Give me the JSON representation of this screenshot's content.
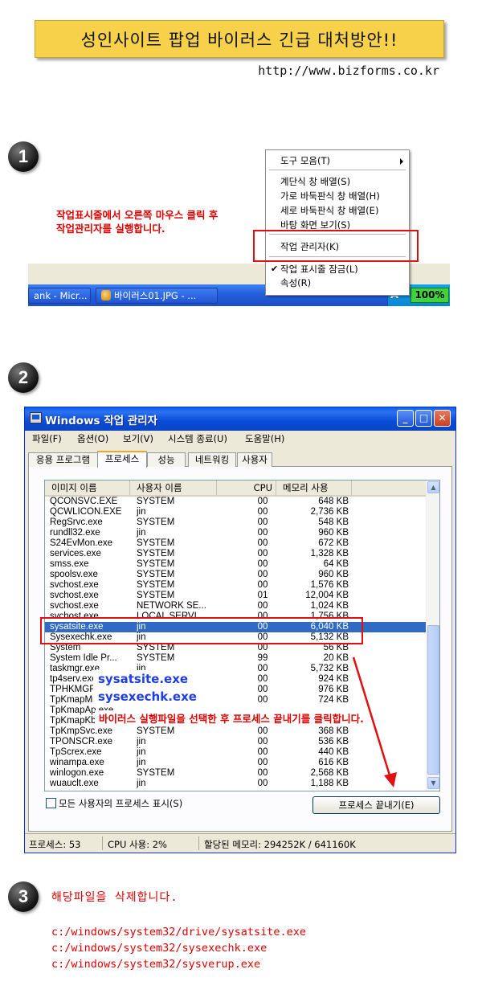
{
  "header": {
    "title": "성인사이트 팝업 바이러스 긴급 대처방안!!",
    "url": "http://www.bizforms.co.kr"
  },
  "step1": {
    "number": "1",
    "instruction_line1": "작업표시줄에서 오른쪽 마우스 클릭 후",
    "instruction_line2": "작업관리자를 실행합니다.",
    "context_menu": {
      "toolbar": "도구 모음(T)",
      "cascade": "계단식 창 배열(S)",
      "tile_h": "가로 바둑판식 창 배열(H)",
      "tile_v": "세로 바둑판식 창 배열(E)",
      "show_desktop": "바탕 화면 보기(S)",
      "task_manager": "작업 관리자(K)",
      "lock_taskbar": "작업 표시줄 잠금(L)",
      "properties": "속성(R)"
    },
    "taskbar": {
      "button1": "ank - Micr...",
      "button2": "바이러스01.JPG - ...",
      "tray_letter": "A",
      "percent": "100%"
    }
  },
  "step2": {
    "number": "2",
    "window": {
      "title": "Windows 작업 관리자",
      "menu": [
        "파일(F)",
        "옵션(O)",
        "보기(V)",
        "시스템 종료(U)",
        "도움말(H)"
      ],
      "tabs": [
        "응용 프로그램",
        "프로세스",
        "성능",
        "네트워킹",
        "사용자"
      ],
      "columns": [
        "이미지 이름",
        "사용자 이름",
        "CPU",
        "메모리 사용"
      ],
      "rows": [
        [
          "QCONSVC.EXE",
          "SYSTEM",
          "00",
          "648 KB"
        ],
        [
          "QCWLICON.EXE",
          "jin",
          "00",
          "2,736 KB"
        ],
        [
          "RegSrvc.exe",
          "SYSTEM",
          "00",
          "548 KB"
        ],
        [
          "rundll32.exe",
          "jin",
          "00",
          "960 KB"
        ],
        [
          "S24EvMon.exe",
          "SYSTEM",
          "00",
          "672 KB"
        ],
        [
          "services.exe",
          "SYSTEM",
          "00",
          "1,328 KB"
        ],
        [
          "smss.exe",
          "SYSTEM",
          "00",
          "64 KB"
        ],
        [
          "spoolsv.exe",
          "SYSTEM",
          "00",
          "960 KB"
        ],
        [
          "svchost.exe",
          "SYSTEM",
          "00",
          "1,576 KB"
        ],
        [
          "svchost.exe",
          "SYSTEM",
          "01",
          "12,004 KB"
        ],
        [
          "svchost.exe",
          "NETWORK SE...",
          "00",
          "1,024 KB"
        ],
        [
          "svchost.exe",
          "LOCAL SERVI...",
          "00",
          "1,756 KB"
        ],
        [
          "sysatsite.exe",
          "jin",
          "00",
          "6,040 KB"
        ],
        [
          "Sysexechk.exe",
          "jin",
          "00",
          "5,132 KB"
        ],
        [
          "System",
          "SYSTEM",
          "00",
          "56 KB"
        ],
        [
          "System Idle Pr...",
          "SYSTEM",
          "99",
          "20 KB"
        ],
        [
          "taskmgr.exe",
          "jin",
          "00",
          "5,732 KB"
        ],
        [
          "tp4serv.exe",
          "",
          "00",
          "924 KB"
        ],
        [
          "TPHKMGR.exe",
          "",
          "00",
          "976 KB"
        ],
        [
          "TpKmapMn.exe",
          "",
          "00",
          "724 KB"
        ],
        [
          "TpKmapAp.exe",
          "",
          "",
          ""
        ],
        [
          "TpKmapKb.exe",
          "",
          "",
          ""
        ],
        [
          "TpKmpSvc.exe",
          "SYSTEM",
          "00",
          "368 KB"
        ],
        [
          "TPONSCR.exe",
          "jin",
          "00",
          "536 KB"
        ],
        [
          "TpScrex.exe",
          "jin",
          "00",
          "440 KB"
        ],
        [
          "winampa.exe",
          "jin",
          "00",
          "616 KB"
        ],
        [
          "winlogon.exe",
          "SYSTEM",
          "00",
          "2,568 KB"
        ],
        [
          "wuauclt.exe",
          "jin",
          "00",
          "1,188 KB"
        ]
      ],
      "selected_row": 12,
      "show_all_users": "모든 사용자의 프로세스 표시(S)",
      "end_process": "프로세스 끝내기(E)",
      "status": {
        "processes": "프로세스: 53",
        "cpu": "CPU 사용: 2%",
        "memory": "할당된 메모리: 294252K / 641160K"
      }
    },
    "overlay_label1": "sysatsite.exe",
    "overlay_label2": "sysexechk.exe",
    "instruction": "바이러스 실행파일을 선택한 후 프로세스 끝내기를 클릭합니다."
  },
  "step3": {
    "number": "3",
    "instruction": "해당파일을 삭제합니다.",
    "paths": [
      "c:/windows/system32/drive/sysatsite.exe",
      "c:/windows/system32/sysexechk.exe",
      "c:/windows/system32/sysverup.exe"
    ]
  }
}
